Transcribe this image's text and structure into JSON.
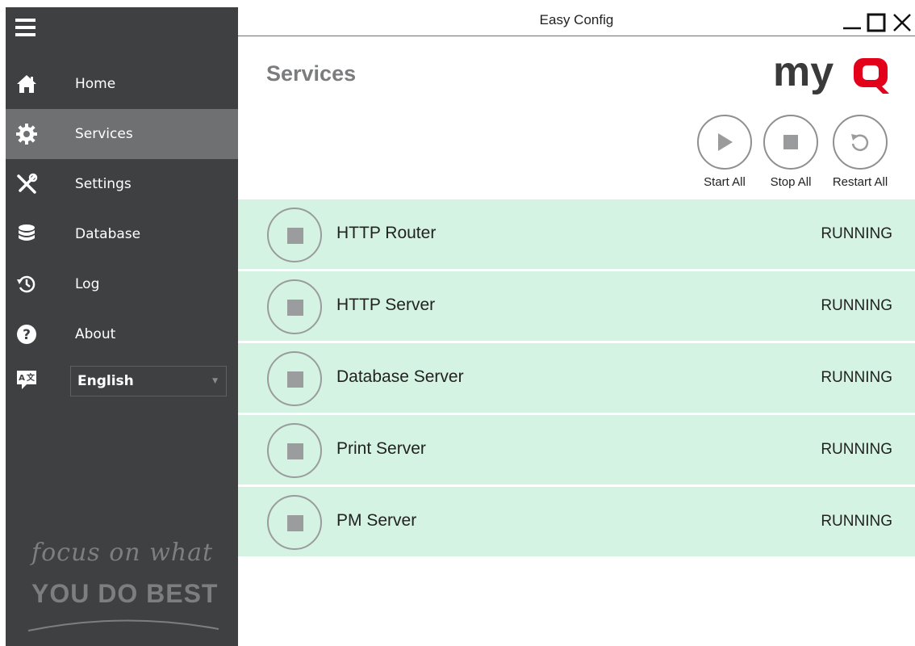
{
  "window": {
    "title": "Easy Config"
  },
  "sidebar": {
    "items": [
      {
        "label": "Home",
        "icon": "home-icon"
      },
      {
        "label": "Services",
        "icon": "gear-icon",
        "active": true
      },
      {
        "label": "Settings",
        "icon": "tools-icon"
      },
      {
        "label": "Database",
        "icon": "database-icon"
      },
      {
        "label": "Log",
        "icon": "history-icon"
      },
      {
        "label": "About",
        "icon": "help-icon"
      }
    ],
    "language": {
      "selected": "English"
    },
    "tagline": {
      "line1": "focus on what",
      "line2": "YOU DO BEST"
    }
  },
  "main": {
    "title": "Services",
    "logo_text": "myq",
    "actions": [
      {
        "label": "Start All",
        "icon": "play-icon"
      },
      {
        "label": "Stop All",
        "icon": "stop-icon"
      },
      {
        "label": "Restart All",
        "icon": "restart-icon"
      }
    ],
    "services": [
      {
        "name": "HTTP Router",
        "status": "RUNNING"
      },
      {
        "name": "HTTP Server",
        "status": "RUNNING"
      },
      {
        "name": "Database Server",
        "status": "RUNNING"
      },
      {
        "name": "Print Server",
        "status": "RUNNING"
      },
      {
        "name": "PM Server",
        "status": "RUNNING"
      }
    ]
  },
  "colors": {
    "sidebar_bg": "#3f4042",
    "sidebar_active": "#6f7072",
    "row_bg": "#d5f3e3",
    "brand_red": "#e3001b"
  }
}
